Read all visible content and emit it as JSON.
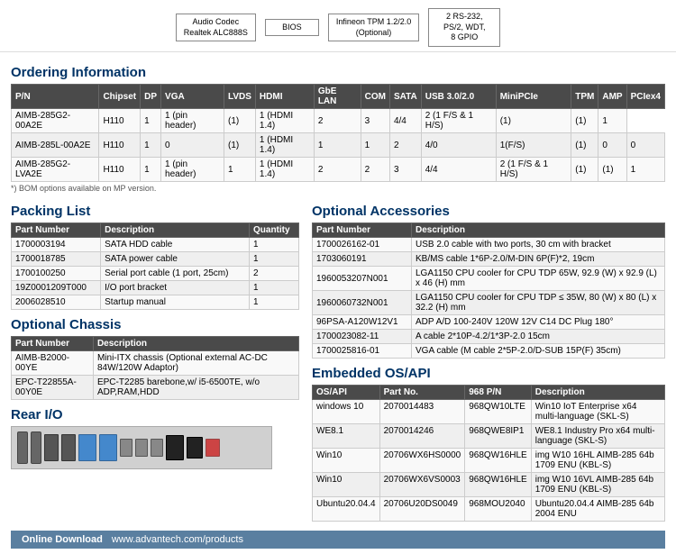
{
  "diagram": {
    "boxes": [
      {
        "label": "Audio Codec\nRealtek ALC888S"
      },
      {
        "label": "BIOS"
      },
      {
        "label": "Infineon TPM 1.2/2.0\n(Optional)"
      },
      {
        "label": "2 RS-232,\nPS/2, WDT,\n8 GPIO"
      }
    ]
  },
  "ordering": {
    "title": "Ordering Information",
    "headers": [
      "P/N",
      "Chipset",
      "DP",
      "VGA",
      "LVDS",
      "HDMI",
      "GbE LAN",
      "COM",
      "SATA",
      "USB 3.0/2.0",
      "MiniPCIe",
      "TPM",
      "AMP",
      "PCIex4"
    ],
    "rows": [
      [
        "AIMB-285G2-00A2E",
        "H110",
        "1",
        "1 (pin header)",
        "(1)",
        "1 (HDMI 1.4)",
        "2",
        "3",
        "4/4",
        "2 (1 F/S & 1 H/S)",
        "(1)",
        "(1)",
        "1"
      ],
      [
        "AIMB-285L-00A2E",
        "H110",
        "1",
        "0",
        "(1)",
        "1 (HDMI 1.4)",
        "1",
        "1",
        "2",
        "4/0",
        "1(F/S)",
        "(1)",
        "0",
        "0"
      ],
      [
        "AIMB-285G2-LVA2E",
        "H110",
        "1",
        "1 (pin header)",
        "1",
        "1 (HDMI 1.4)",
        "2",
        "2",
        "3",
        "4/4",
        "2 (1 F/S & 1 H/S)",
        "(1)",
        "(1)",
        "1"
      ]
    ],
    "note": "*) BOM options available on MP version."
  },
  "packing_list": {
    "title": "Packing List",
    "headers": [
      "Part Number",
      "Description",
      "Quantity"
    ],
    "rows": [
      [
        "1700003194",
        "SATA HDD cable",
        "1"
      ],
      [
        "1700018785",
        "SATA power cable",
        "1"
      ],
      [
        "1700100250",
        "Serial port cable (1 port, 25cm)",
        "2"
      ],
      [
        "19Z0001209T000",
        "I/O port bracket",
        "1"
      ],
      [
        "2006028510",
        "Startup manual",
        "1"
      ]
    ]
  },
  "optional_chassis": {
    "title": "Optional Chassis",
    "headers": [
      "Part Number",
      "Description"
    ],
    "rows": [
      [
        "AIMB-B2000-00YE",
        "Mini-ITX chassis (Optional external AC-DC 84W/120W Adaptor)"
      ],
      [
        "EPC-T22855A-00Y0E",
        "EPC-T2285 barebone,w/ i5-6500TE, w/o ADP,RAM,HDD"
      ]
    ]
  },
  "rear_io": {
    "title": "Rear I/O"
  },
  "optional_accessories": {
    "title": "Optional Accessories",
    "headers": [
      "Part Number",
      "Description"
    ],
    "rows": [
      [
        "1700026162-01",
        "USB 2.0 cable with two ports, 30 cm with bracket"
      ],
      [
        "1703060191",
        "KB/MS cable 1*6P-2.0/M-DIN 6P(F)*2, 19cm"
      ],
      [
        "1960053207N001",
        "LGA1150 CPU cooler for CPU TDP 65W, 92.9 (W) x 92.9 (L) x 46 (H) mm"
      ],
      [
        "1960060732N001",
        "LGA1150 CPU cooler for CPU TDP ≤ 35W, 80 (W) x 80 (L) x 32.2 (H) mm"
      ],
      [
        "96PSA-A120W12V1",
        "ADP A/D 100-240V 120W 12V C14 DC Plug 180°"
      ],
      [
        "1700023082-11",
        "A cable 2*10P-4.2/1*3P-2.0 15cm"
      ],
      [
        "1700025816-01",
        "VGA cable (M cable 2*5P-2.0/D-SUB 15P(F) 35cm)"
      ]
    ]
  },
  "embedded_os": {
    "title": "Embedded OS/API",
    "headers": [
      "OS/API",
      "Part No.",
      "968 P/N",
      "Description"
    ],
    "rows": [
      [
        "windows 10",
        "2070014483",
        "968QW10LTE",
        "Win10 IoT Enterprise x64 multi-language (SKL-S)"
      ],
      [
        "WE8.1",
        "2070014246",
        "968QWE8IP1",
        "WE8.1 Industry Pro x64 multi-language (SKL-S)"
      ],
      [
        "Win10",
        "20706WX6HS0000",
        "968QW16HLE",
        "img W10 16HL AIMB-285 64b 1709 ENU (KBL-S)"
      ],
      [
        "Win10",
        "20706WX6VS0003",
        "968QW16HLE",
        "img W10 16VL AIMB-285 64b 1709 ENU (KBL-S)"
      ],
      [
        "Ubuntu20.04.4",
        "20706U20DS0049",
        "968MOU2040",
        "Ubuntu20.04.4 AIMB-285 64b 2004 ENU"
      ]
    ]
  },
  "online_download": {
    "label": "Online Download",
    "url": "www.advantech.com/products"
  }
}
